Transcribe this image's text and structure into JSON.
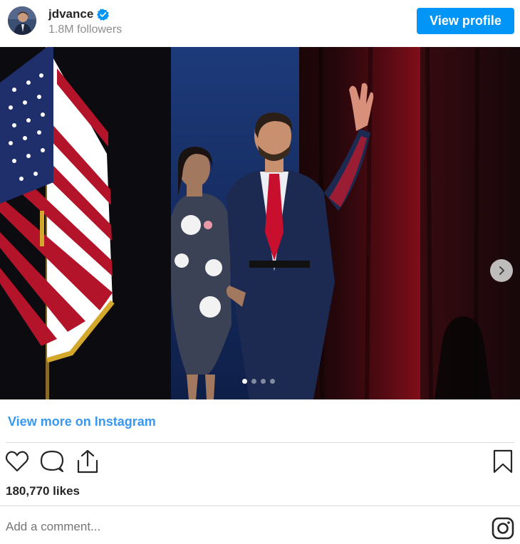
{
  "header": {
    "username": "jdvance",
    "verified_icon": "verified-badge-icon",
    "followers": "1.8M followers",
    "view_profile_label": "View profile"
  },
  "post": {
    "carousel": {
      "slide_count": 4,
      "active_slide": 1,
      "next_icon": "chevron-right-icon"
    },
    "view_more_label": "View more on Instagram",
    "actions": {
      "like_icon": "heart-icon",
      "comment_icon": "comment-bubble-icon",
      "share_icon": "share-icon",
      "save_icon": "bookmark-icon"
    },
    "likes": "180,770 likes",
    "comment_placeholder": "Add a comment...",
    "instagram_icon": "instagram-logo-icon"
  },
  "colors": {
    "accent": "#0095f6",
    "link": "#3897f0",
    "muted": "#8e8e8e",
    "text": "#262626"
  }
}
